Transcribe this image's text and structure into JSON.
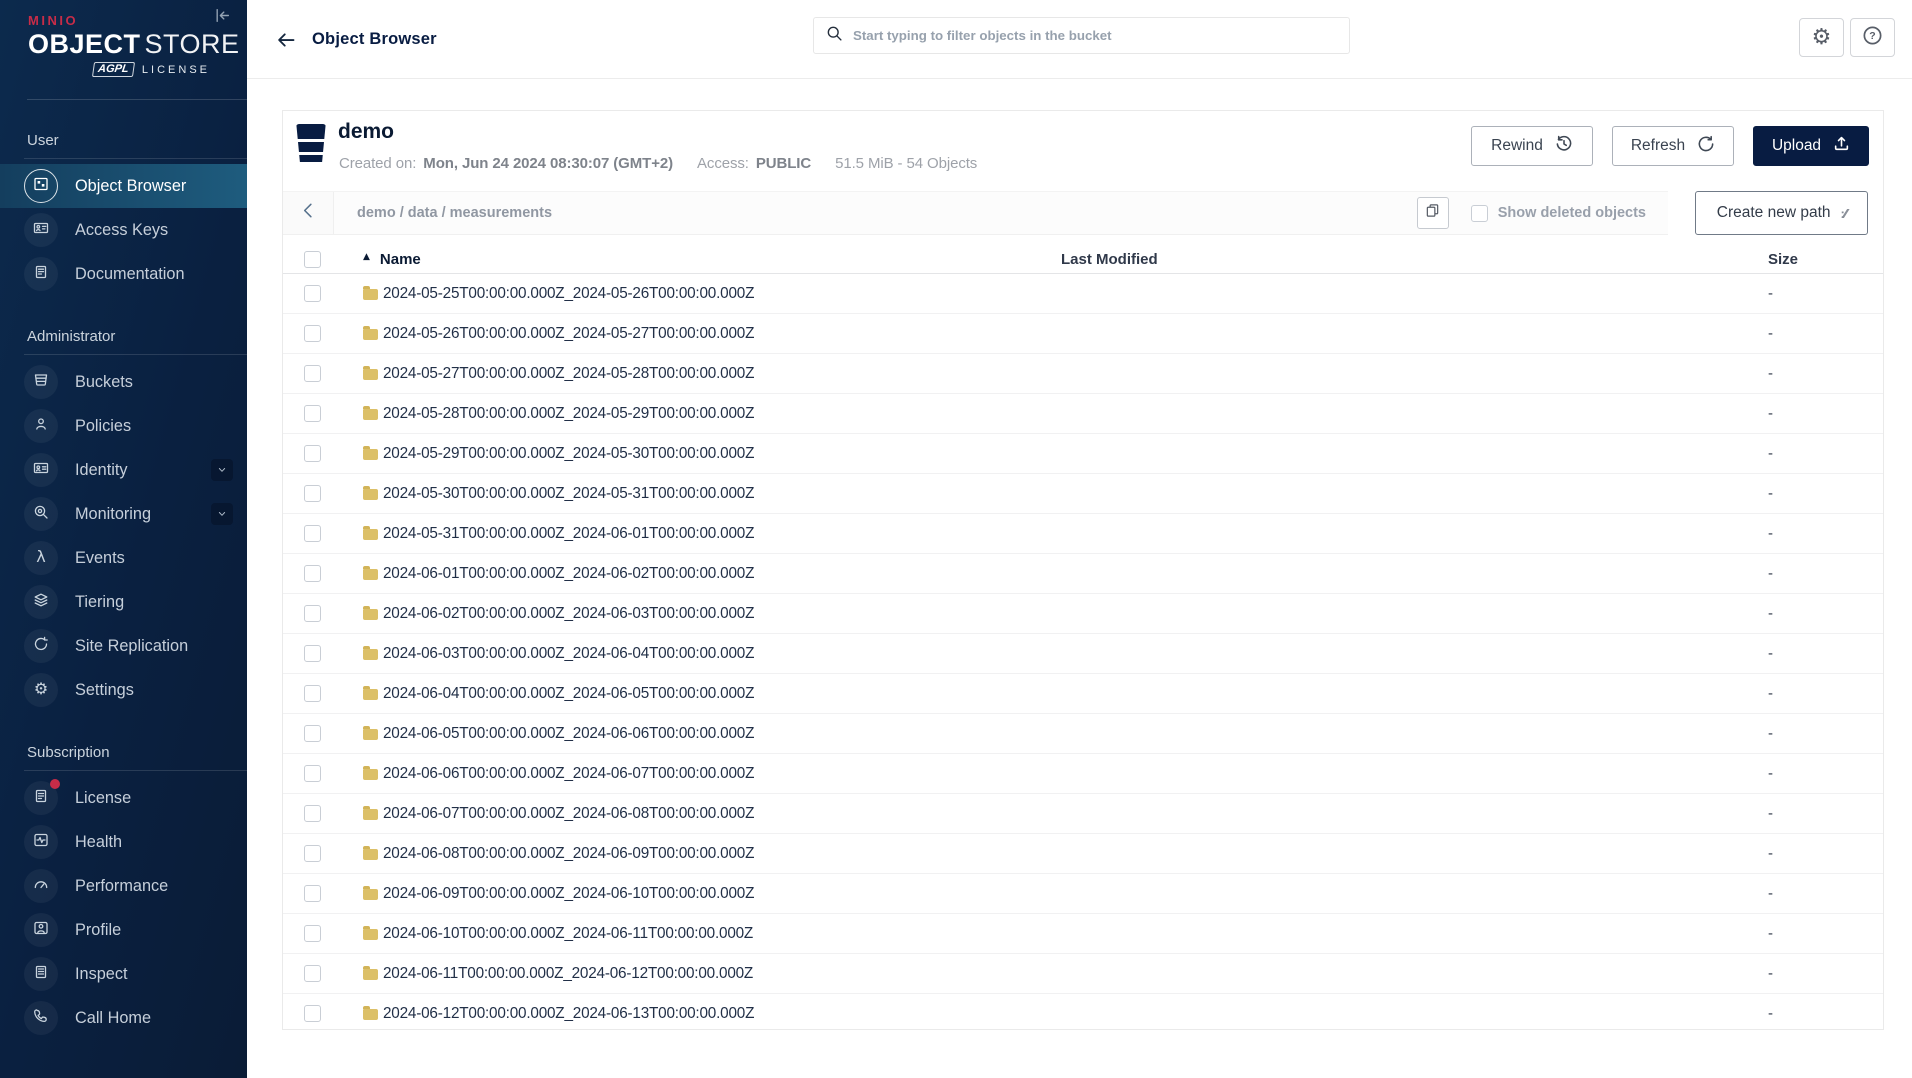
{
  "colors": {
    "navy": "#081C42",
    "brand_red": "#C72C48",
    "selected_highlight": "#1E5C7E",
    "folder": "#DCC068"
  },
  "sidebar": {
    "logo": {
      "brand": "MINIO",
      "product_bold": "OBJECT",
      "product_light": "STORE",
      "license_badge": "AGPL",
      "license_text": "LICENSE"
    },
    "sections": [
      {
        "label": "User",
        "items": [
          {
            "label": "Object Browser",
            "icon": "object-browser-icon",
            "selected": true
          },
          {
            "label": "Access Keys",
            "icon": "access-keys-icon"
          },
          {
            "label": "Documentation",
            "icon": "documentation-icon"
          }
        ]
      },
      {
        "label": "Administrator",
        "items": [
          {
            "label": "Buckets",
            "icon": "buckets-icon"
          },
          {
            "label": "Policies",
            "icon": "policies-icon"
          },
          {
            "label": "Identity",
            "icon": "identity-icon",
            "has_submenu": true
          },
          {
            "label": "Monitoring",
            "icon": "monitoring-icon",
            "has_submenu": true
          },
          {
            "label": "Events",
            "icon": "events-icon"
          },
          {
            "label": "Tiering",
            "icon": "tiering-icon"
          },
          {
            "label": "Site Replication",
            "icon": "site-replication-icon"
          },
          {
            "label": "Settings",
            "icon": "settings-icon"
          }
        ]
      },
      {
        "label": "Subscription",
        "items": [
          {
            "label": "License",
            "icon": "license-icon",
            "badge": true
          },
          {
            "label": "Health",
            "icon": "health-icon"
          },
          {
            "label": "Performance",
            "icon": "performance-icon"
          },
          {
            "label": "Profile",
            "icon": "profile-icon"
          },
          {
            "label": "Inspect",
            "icon": "inspect-icon"
          },
          {
            "label": "Call Home",
            "icon": "call-home-icon"
          }
        ]
      }
    ]
  },
  "header": {
    "title": "Object Browser",
    "search_placeholder": "Start typing to filter objects in the bucket"
  },
  "bucket": {
    "name": "demo",
    "created_label": "Created on:",
    "created_value": "Mon, Jun 24 2024 08:30:07 (GMT+2)",
    "access_label": "Access:",
    "access_value": "PUBLIC",
    "usage": "51.5 MiB - 54 Objects",
    "rewind": "Rewind",
    "refresh": "Refresh",
    "upload": "Upload"
  },
  "path_bar": {
    "breadcrumb": "demo / data / measurements",
    "show_deleted": "Show deleted objects",
    "create_path": "Create new path"
  },
  "table": {
    "name_header": "Name",
    "modified_header": "Last Modified",
    "size_header": "Size",
    "rows": [
      {
        "name": "2024-05-25T00:00:00.000Z_2024-05-26T00:00:00.000Z",
        "last_modified": "",
        "size": "-"
      },
      {
        "name": "2024-05-26T00:00:00.000Z_2024-05-27T00:00:00.000Z",
        "last_modified": "",
        "size": "-"
      },
      {
        "name": "2024-05-27T00:00:00.000Z_2024-05-28T00:00:00.000Z",
        "last_modified": "",
        "size": "-"
      },
      {
        "name": "2024-05-28T00:00:00.000Z_2024-05-29T00:00:00.000Z",
        "last_modified": "",
        "size": "-"
      },
      {
        "name": "2024-05-29T00:00:00.000Z_2024-05-30T00:00:00.000Z",
        "last_modified": "",
        "size": "-"
      },
      {
        "name": "2024-05-30T00:00:00.000Z_2024-05-31T00:00:00.000Z",
        "last_modified": "",
        "size": "-"
      },
      {
        "name": "2024-05-31T00:00:00.000Z_2024-06-01T00:00:00.000Z",
        "last_modified": "",
        "size": "-"
      },
      {
        "name": "2024-06-01T00:00:00.000Z_2024-06-02T00:00:00.000Z",
        "last_modified": "",
        "size": "-"
      },
      {
        "name": "2024-06-02T00:00:00.000Z_2024-06-03T00:00:00.000Z",
        "last_modified": "",
        "size": "-"
      },
      {
        "name": "2024-06-03T00:00:00.000Z_2024-06-04T00:00:00.000Z",
        "last_modified": "",
        "size": "-"
      },
      {
        "name": "2024-06-04T00:00:00.000Z_2024-06-05T00:00:00.000Z",
        "last_modified": "",
        "size": "-"
      },
      {
        "name": "2024-06-05T00:00:00.000Z_2024-06-06T00:00:00.000Z",
        "last_modified": "",
        "size": "-"
      },
      {
        "name": "2024-06-06T00:00:00.000Z_2024-06-07T00:00:00.000Z",
        "last_modified": "",
        "size": "-"
      },
      {
        "name": "2024-06-07T00:00:00.000Z_2024-06-08T00:00:00.000Z",
        "last_modified": "",
        "size": "-"
      },
      {
        "name": "2024-06-08T00:00:00.000Z_2024-06-09T00:00:00.000Z",
        "last_modified": "",
        "size": "-"
      },
      {
        "name": "2024-06-09T00:00:00.000Z_2024-06-10T00:00:00.000Z",
        "last_modified": "",
        "size": "-"
      },
      {
        "name": "2024-06-10T00:00:00.000Z_2024-06-11T00:00:00.000Z",
        "last_modified": "",
        "size": "-"
      },
      {
        "name": "2024-06-11T00:00:00.000Z_2024-06-12T00:00:00.000Z",
        "last_modified": "",
        "size": "-"
      },
      {
        "name": "2024-06-12T00:00:00.000Z_2024-06-13T00:00:00.000Z",
        "last_modified": "",
        "size": "-"
      }
    ]
  }
}
